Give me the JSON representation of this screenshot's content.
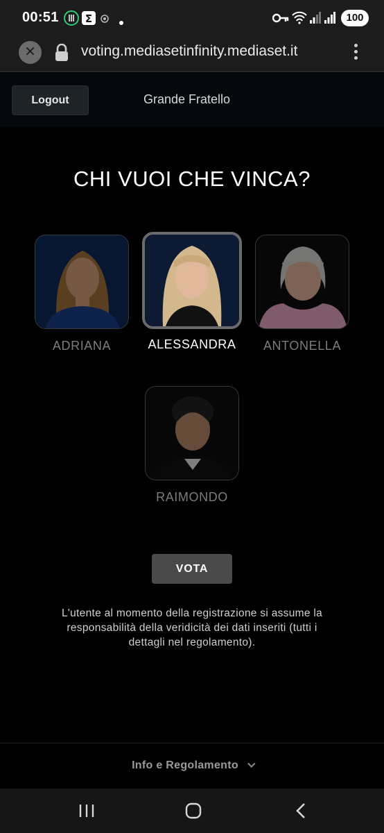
{
  "status_bar": {
    "time": "00:51",
    "battery": "100",
    "icons": [
      "restaurant-app-icon",
      "sigma-app-icon",
      "circle-app-icon",
      "dot-icon",
      "key-icon",
      "wifi-icon",
      "signal-icon",
      "signal-icon-2"
    ]
  },
  "browser": {
    "url": "voting.mediasetinfinity.mediaset.it"
  },
  "header": {
    "logout_label": "Logout",
    "show_title": "Grande Fratello"
  },
  "main": {
    "question": "CHI VUOI CHE VINCA?",
    "candidates": [
      {
        "name": "ADRIANA",
        "selected": false,
        "bg": "#0e2a5a",
        "hair": "#a2743a",
        "skin": "#d7a07c",
        "outfit": "#1c3f8a"
      },
      {
        "name": "ALESSANDRA",
        "selected": true,
        "bg": "#0c1a33",
        "hair": "#d4b88d",
        "skin": "#e2b89c",
        "outfit": "#111111"
      },
      {
        "name": "ANTONELLA",
        "selected": false,
        "bg": "#0d0d0d",
        "hair": "#d6d6d2",
        "skin": "#e4b49c",
        "outfit": "#e7a7c3"
      },
      {
        "name": "RAIMONDO",
        "selected": false,
        "bg": "#0d0d0d",
        "hair": "#222222",
        "skin": "#b98a6b",
        "outfit": "#111111"
      }
    ],
    "vote_label": "VOTA",
    "disclaimer": "L'utente al momento della registrazione si assume la responsabilità della veridicità dei dati inseriti (tutti i dettagli nel regolamento)."
  },
  "footer": {
    "info_label": "Info e Regolamento"
  },
  "colors": {
    "background": "#000000",
    "button_bg": "#4a4a4a",
    "muted_text": "#7d7d7d"
  }
}
